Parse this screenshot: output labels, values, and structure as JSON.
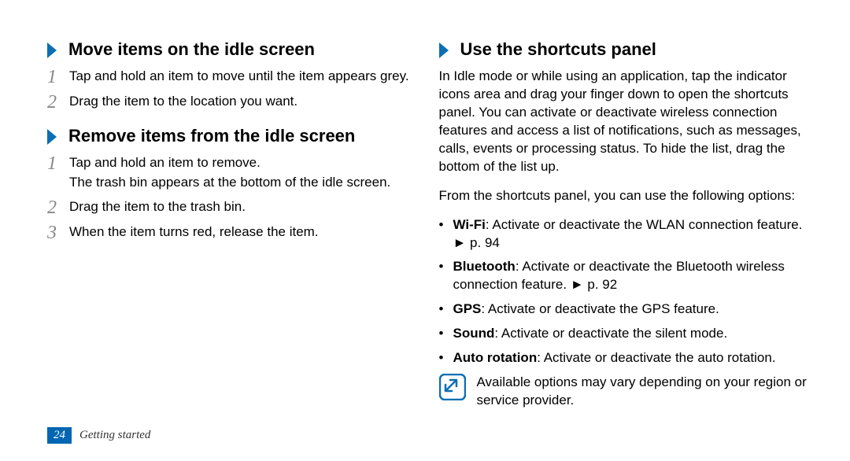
{
  "left": {
    "section1": {
      "title": "Move items on the idle screen",
      "steps": [
        {
          "n": "1",
          "text": "Tap and hold an item to move until the item appears grey."
        },
        {
          "n": "2",
          "text": "Drag the item to the location you want."
        }
      ]
    },
    "section2": {
      "title": "Remove items from the idle screen",
      "steps": [
        {
          "n": "1",
          "text": "Tap and hold an item to remove.",
          "sub": "The trash bin appears at the bottom of the idle screen."
        },
        {
          "n": "2",
          "text": "Drag the item to the trash bin."
        },
        {
          "n": "3",
          "text": "When the item turns red, release the item."
        }
      ]
    }
  },
  "right": {
    "title": "Use the shortcuts panel",
    "para1": "In Idle mode or while using an application, tap the indicator icons area and drag your finger down to open the shortcuts panel. You can activate or deactivate wireless connection features and access a list of notifications, such as messages, calls, events or processing status. To hide the list, drag the bottom of the list up.",
    "para2": "From the shortcuts panel, you can use the following options:",
    "bullets": [
      {
        "strong": "Wi-Fi",
        "rest": ": Activate or deactivate the WLAN connection feature. ► p. 94"
      },
      {
        "strong": "Bluetooth",
        "rest": ": Activate or deactivate the Bluetooth wireless connection feature. ► p. 92"
      },
      {
        "strong": "GPS",
        "rest": ": Activate or deactivate the GPS feature."
      },
      {
        "strong": "Sound",
        "rest": ": Activate or deactivate the silent mode."
      },
      {
        "strong": "Auto rotation",
        "rest": ": Activate or deactivate the auto rotation."
      }
    ],
    "note": "Available options may vary depending on your region or service provider."
  },
  "footer": {
    "page": "24",
    "section": "Getting started"
  }
}
